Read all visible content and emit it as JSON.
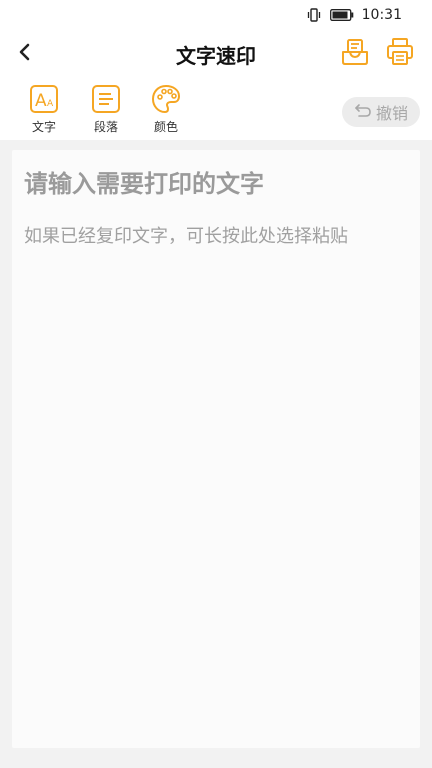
{
  "status_bar": {
    "time": "10:31",
    "icons": [
      "vibrate-icon",
      "battery-icon"
    ]
  },
  "header": {
    "title": "文字速印",
    "back_icon": "chevron-left-icon",
    "actions": [
      "inbox-tray-icon",
      "printer-icon"
    ]
  },
  "toolbar": {
    "tools": [
      {
        "label": "文字",
        "icon": "text-font-icon"
      },
      {
        "label": "段落",
        "icon": "paragraph-icon"
      },
      {
        "label": "颜色",
        "icon": "palette-icon"
      }
    ],
    "undo_label": "撤销",
    "undo_icon": "undo-icon"
  },
  "editor": {
    "heading_placeholder": "请输入需要打印的文字",
    "hint_placeholder": "如果已经复印文字，可长按此处选择粘贴"
  },
  "colors": {
    "accent": "#f5a623",
    "background": "#f2f2f2",
    "surface": "#ffffff",
    "placeholder": "#9a9a9a"
  }
}
